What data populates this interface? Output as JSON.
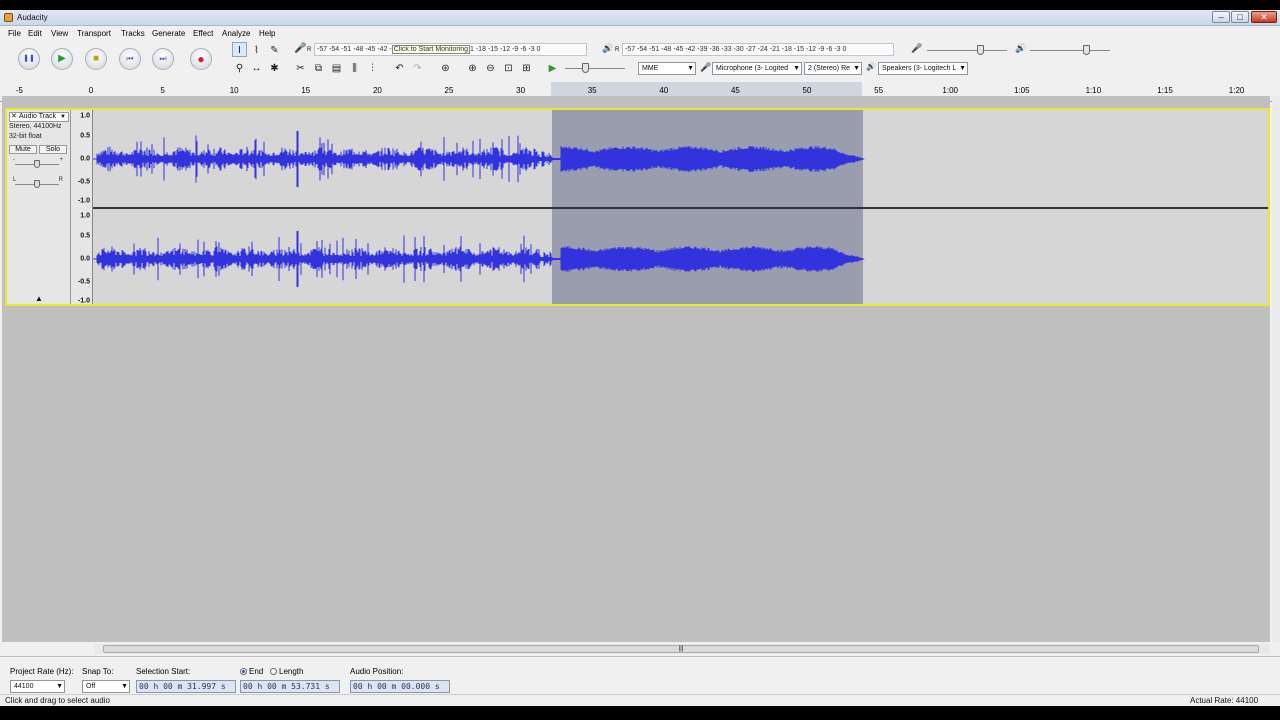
{
  "window": {
    "title": "Audacity",
    "minimize": "–",
    "maximize": "□",
    "close": "✕"
  },
  "menu": [
    "File",
    "Edit",
    "View",
    "Transport",
    "Tracks",
    "Generate",
    "Effect",
    "Analyze",
    "Help"
  ],
  "transport": {
    "pause": "❚❚",
    "play": "▶",
    "stop": "■",
    "skip_start": "⏮",
    "skip_end": "⏭",
    "record": "●"
  },
  "meters": {
    "record_scale": "-57 -54 -51 -48 -45 -42 -",
    "record_tip": "Click to Start Monitoring",
    "record_scale2": "1 -18 -15 -12  -9  -6  -3  0",
    "playback_scale": "-57 -54 -51 -48 -45 -42 -39 -36 -33 -30 -27 -24 -21 -18 -15 -12  -9  -6  -3  0",
    "rec_label": "R",
    "play_label": "R"
  },
  "device": {
    "host": "MME",
    "mic": "Microphone (3- Logited",
    "channels": "2 (Stereo) Re",
    "speakers": "Speakers (3- Logitech L"
  },
  "ruler": {
    "labels": [
      "-5",
      "0",
      "5",
      "10",
      "15",
      "20",
      "25",
      "30",
      "35",
      "40",
      "45",
      "50",
      "55",
      "1:00",
      "1:05",
      "1:10",
      "1:15",
      "1:20"
    ]
  },
  "track": {
    "name": "Audio Track",
    "info_rate": "Stereo, 44100Hz",
    "info_format": "32-bit float",
    "mute": "Mute",
    "solo": "Solo",
    "pan_l": "L",
    "pan_r": "R",
    "gain_minus": "-",
    "gain_plus": "+",
    "collapse": "▲",
    "vlabels_top": [
      "1.0",
      "0.5",
      "0.0",
      "-0.5",
      "-1.0"
    ],
    "vlabels_bottom": [
      "1.0",
      "0.5",
      "0.0",
      "-0.5",
      "-1.0"
    ]
  },
  "selectionbar": {
    "project_rate_label": "Project Rate (Hz):",
    "project_rate": "44100",
    "snap_label": "Snap To:",
    "snap_value": "Off",
    "sel_start_label": "Selection Start:",
    "sel_start": "00 h 00 m 31.997 s",
    "end_label": "End",
    "length_label": "Length",
    "sel_end": "00 h 00 m 53.731 s",
    "audio_pos_label": "Audio Position:",
    "audio_pos": "00 h 00 m 00.000 s"
  },
  "status": {
    "left": "Click and drag to select audio",
    "right": "Actual Rate: 44100"
  },
  "colors": {
    "waveform": "#3333dd",
    "selection": "#9a9dad",
    "track_border": "#e8e830"
  }
}
